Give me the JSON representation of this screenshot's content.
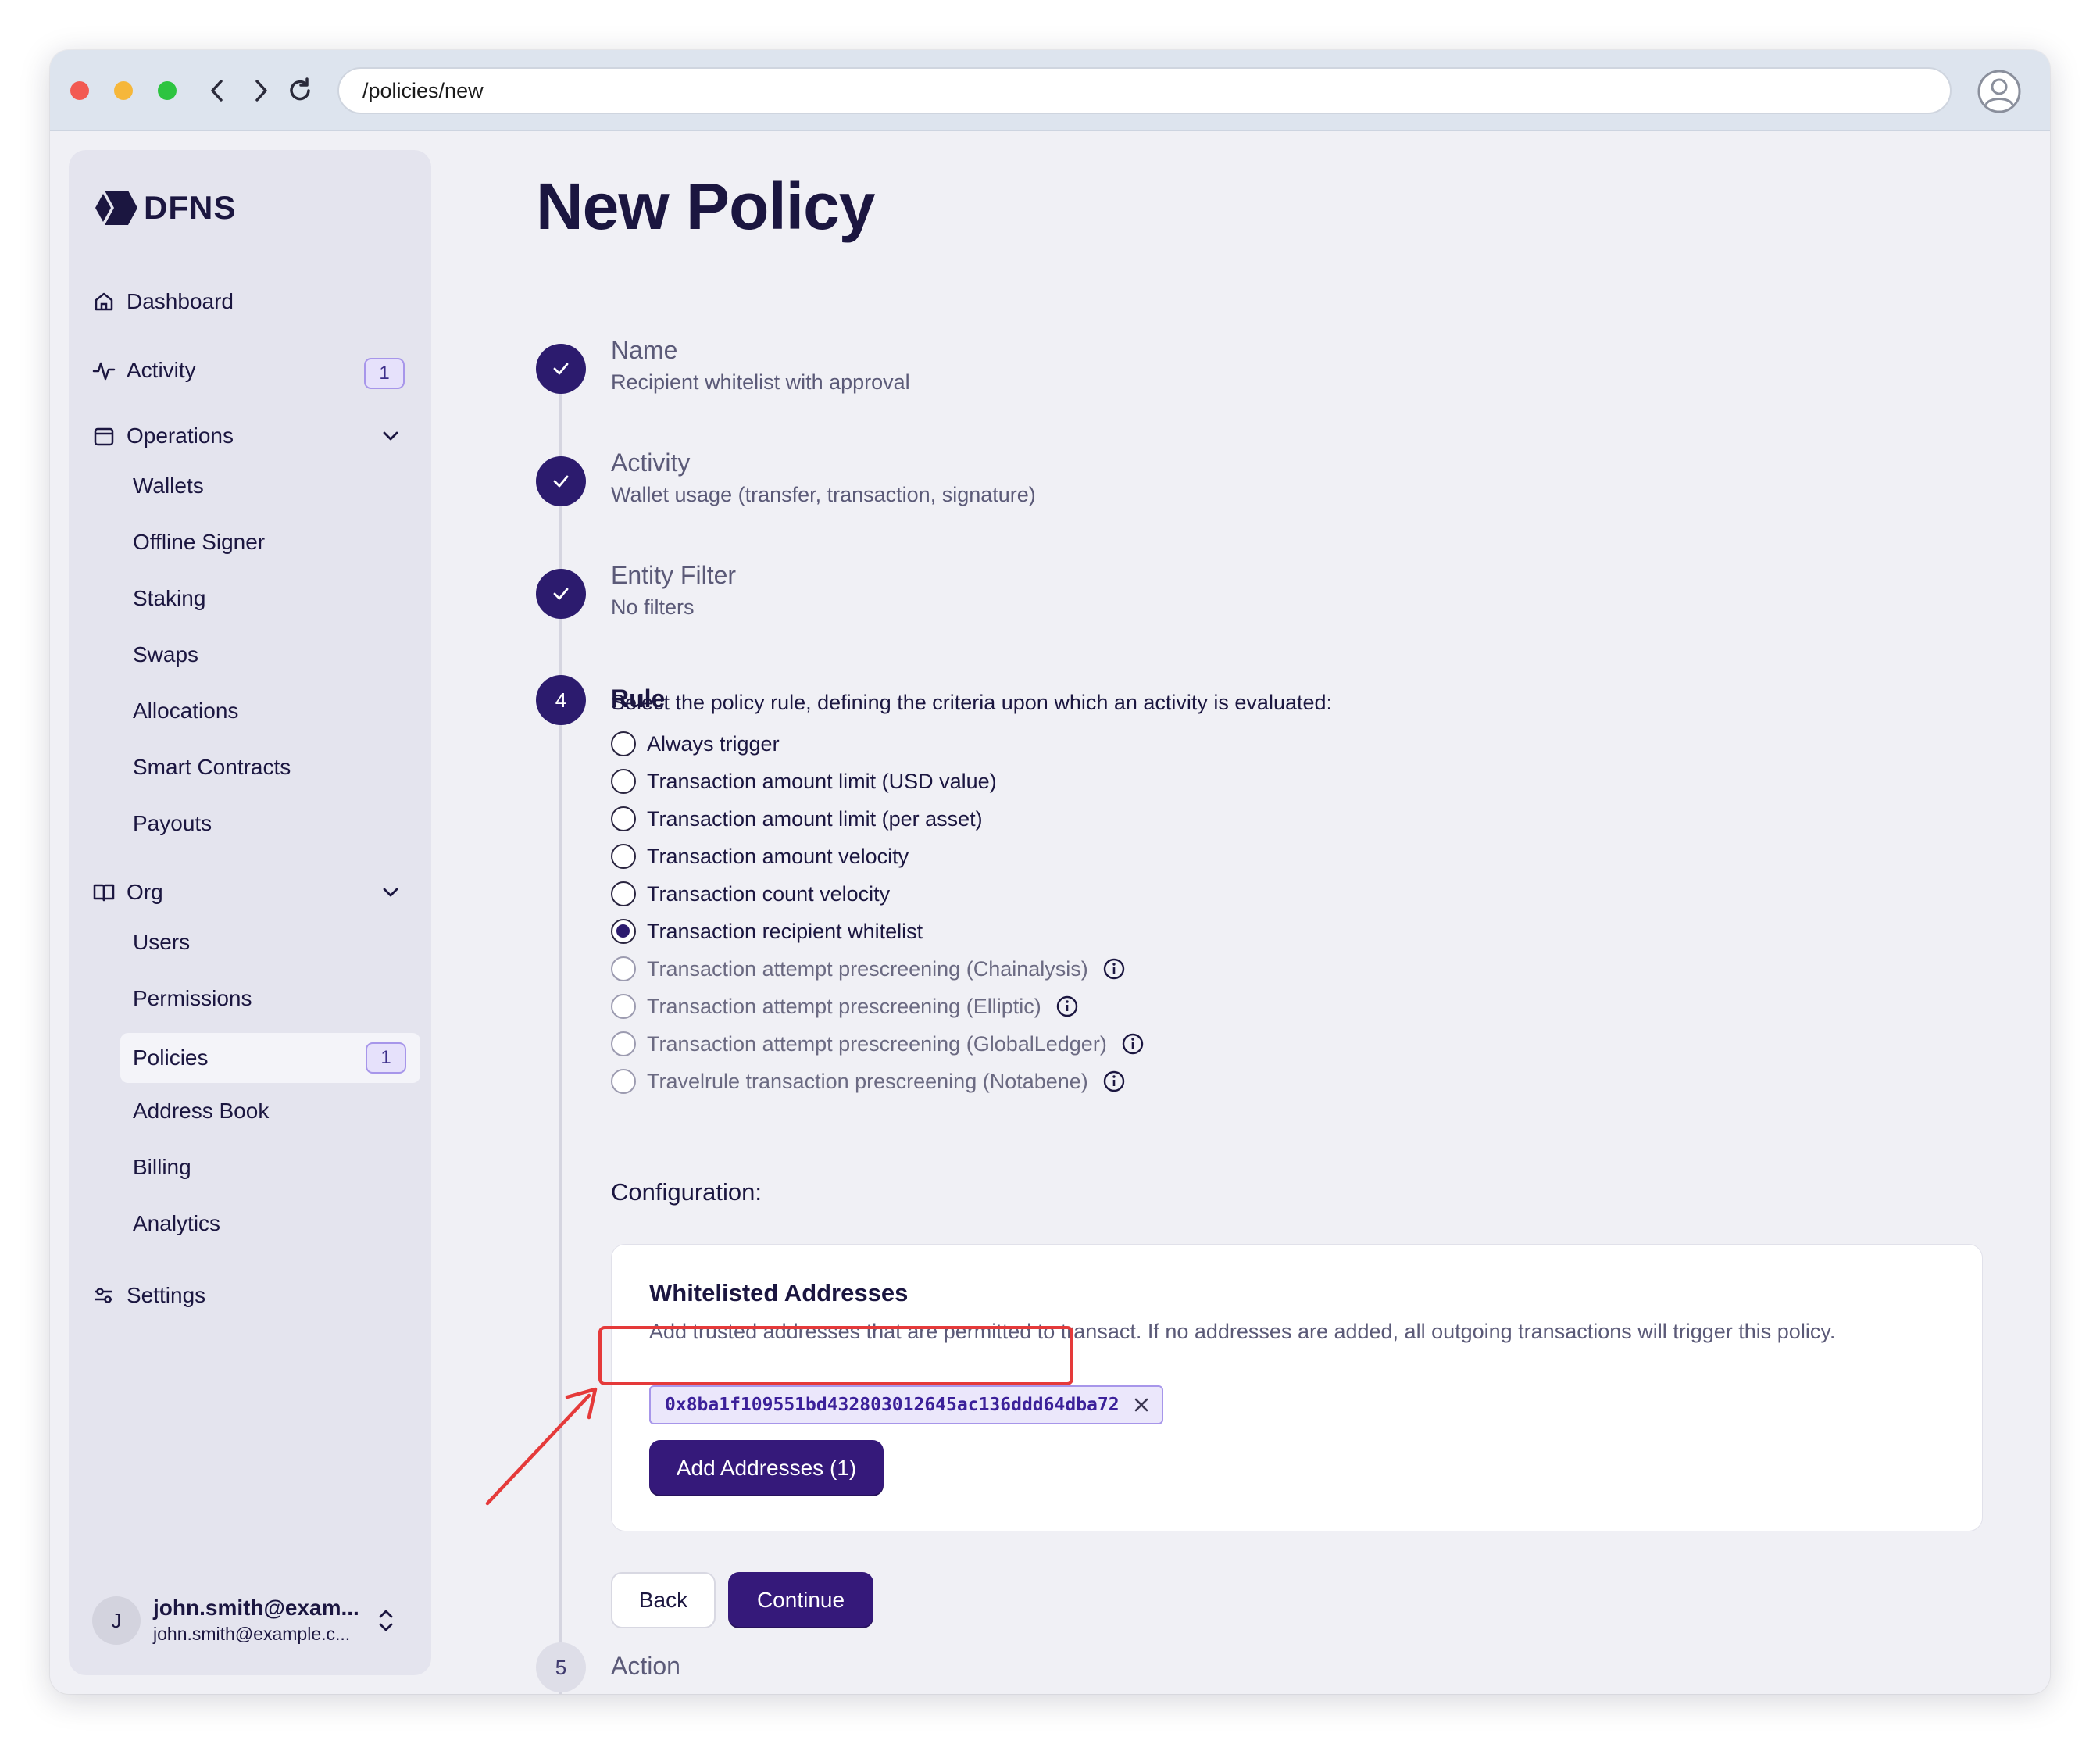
{
  "browser": {
    "url": "/policies/new"
  },
  "sidebar": {
    "logo": "DFNS",
    "dashboard": "Dashboard",
    "activity": {
      "label": "Activity",
      "badge": "1"
    },
    "operations": {
      "label": "Operations",
      "items": [
        "Wallets",
        "Offline Signer",
        "Staking",
        "Swaps",
        "Allocations",
        "Smart Contracts",
        "Payouts"
      ]
    },
    "org": {
      "label": "Org",
      "items": [
        "Users",
        "Permissions",
        "Policies",
        "Address Book",
        "Billing",
        "Analytics"
      ],
      "policies_badge": "1"
    },
    "settings": "Settings",
    "user": {
      "initial": "J",
      "name": "john.smith@exam...",
      "email": "john.smith@example.c..."
    }
  },
  "page": {
    "title": "New Policy",
    "steps": [
      {
        "title": "Name",
        "subtitle": "Recipient whitelist with approval"
      },
      {
        "title": "Activity",
        "subtitle": "Wallet usage (transfer, transaction, signature)"
      },
      {
        "title": "Entity Filter",
        "subtitle": "No filters"
      },
      {
        "number": "4",
        "title": "Rule"
      },
      {
        "number": "5",
        "title": "Action"
      }
    ],
    "rule": {
      "description": "Select the policy rule, defining the criteria upon which an activity is evaluated:",
      "options": [
        "Always trigger",
        "Transaction amount limit (USD value)",
        "Transaction amount limit (per asset)",
        "Transaction amount velocity",
        "Transaction count velocity",
        "Transaction recipient whitelist",
        "Transaction attempt prescreening (Chainalysis)",
        "Transaction attempt prescreening (Elliptic)",
        "Transaction attempt prescreening (GlobalLedger)",
        "Travelrule transaction prescreening (Notabene)"
      ],
      "selected": "Transaction recipient whitelist"
    },
    "configuration": {
      "label": "Configuration:",
      "card_title": "Whitelisted Addresses",
      "card_description": "Add trusted addresses that are permitted to transact. If no addresses are added, all outgoing transactions will trigger this policy.",
      "address": "0x8ba1f109551bd432803012645ac136ddd64dba72",
      "add_button": "Add Addresses (1)"
    },
    "back_button": "Back",
    "continue_button": "Continue"
  },
  "colors": {
    "accent": "#35197a",
    "annotation": "#e53a3a",
    "badge_border": "#a796ea"
  }
}
